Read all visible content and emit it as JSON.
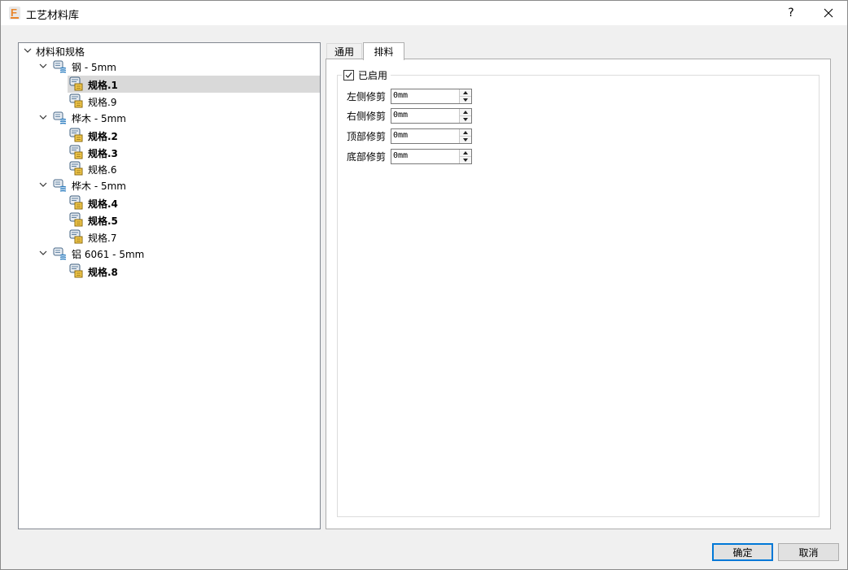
{
  "window": {
    "title": "工艺材料库",
    "help": "?",
    "close": "✕"
  },
  "tree": {
    "root": "材料和规格",
    "materials": [
      {
        "label": "钢 - 5mm",
        "specs": [
          {
            "label": "规格.1",
            "bold": true,
            "selected": true
          },
          {
            "label": "规格.9",
            "bold": false
          }
        ]
      },
      {
        "label": "桦木 - 5mm",
        "specs": [
          {
            "label": "规格.2",
            "bold": true
          },
          {
            "label": "规格.3",
            "bold": true
          },
          {
            "label": "规格.6",
            "bold": false
          }
        ]
      },
      {
        "label": "桦木 - 5mm",
        "specs": [
          {
            "label": "规格.4",
            "bold": true
          },
          {
            "label": "规格.5",
            "bold": true
          },
          {
            "label": "规格.7",
            "bold": false
          }
        ]
      },
      {
        "label": "铝 6061 - 5mm",
        "specs": [
          {
            "label": "规格.8",
            "bold": true
          }
        ]
      }
    ]
  },
  "tabs": [
    {
      "label": "通用",
      "active": false
    },
    {
      "label": "排料",
      "active": true
    }
  ],
  "nesting": {
    "enabled_label": "已启用",
    "enabled": true,
    "fields": [
      {
        "label": "左侧修剪",
        "value": "0mm"
      },
      {
        "label": "右侧修剪",
        "value": "0mm"
      },
      {
        "label": "顶部修剪",
        "value": "0mm"
      },
      {
        "label": "底部修剪",
        "value": "0mm"
      }
    ]
  },
  "buttons": {
    "ok": "确定",
    "cancel": "取消"
  },
  "colors": {
    "selection": "#d9d9d9",
    "accent": "#0078d7",
    "app_icon": "#e8842a"
  }
}
